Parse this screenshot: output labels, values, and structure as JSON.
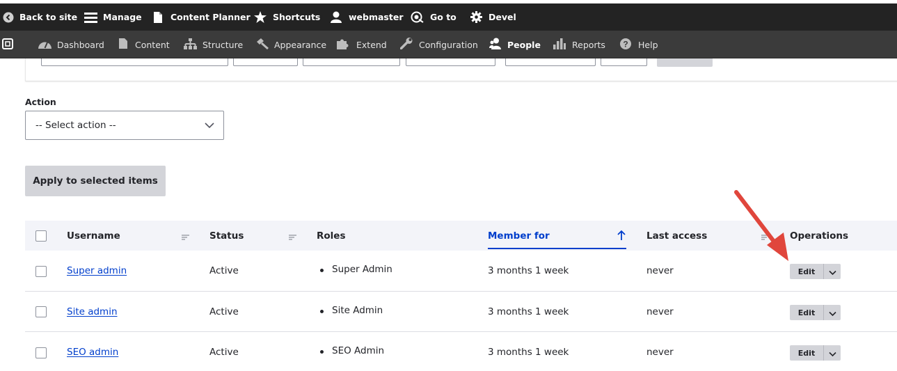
{
  "toolbar": {
    "back": "Back to site",
    "manage": "Manage",
    "content_planner": "Content Planner",
    "shortcuts": "Shortcuts",
    "user": "webmaster",
    "goto": "Go to",
    "devel": "Devel"
  },
  "tray": {
    "dashboard": "Dashboard",
    "content": "Content",
    "structure": "Structure",
    "appearance": "Appearance",
    "extend": "Extend",
    "configuration": "Configuration",
    "people": "People",
    "reports": "Reports",
    "help": "Help"
  },
  "bulk": {
    "label": "Action",
    "selected": "-- Select action --",
    "apply": "Apply to selected items"
  },
  "table": {
    "headers": {
      "username": "Username",
      "status": "Status",
      "roles": "Roles",
      "member_for": "Member for",
      "last_access": "Last access",
      "operations": "Operations"
    },
    "rows": [
      {
        "username": "Super admin",
        "status": "Active",
        "role": "Super Admin",
        "member_for": "3 months 1 week",
        "last_access": "never",
        "edit": "Edit"
      },
      {
        "username": "Site admin",
        "status": "Active",
        "role": "Site Admin",
        "member_for": "3 months 1 week",
        "last_access": "never",
        "edit": "Edit"
      },
      {
        "username": "SEO admin",
        "status": "Active",
        "role": "SEO Admin",
        "member_for": "3 months 1 week",
        "last_access": "never",
        "edit": "Edit"
      }
    ]
  },
  "colors": {
    "toolbar_bg": "#232323",
    "tray_bg": "#3b3b3b",
    "link": "#003ecc",
    "button_bg": "#d3d4d9",
    "annotation_arrow": "#e0463c"
  }
}
